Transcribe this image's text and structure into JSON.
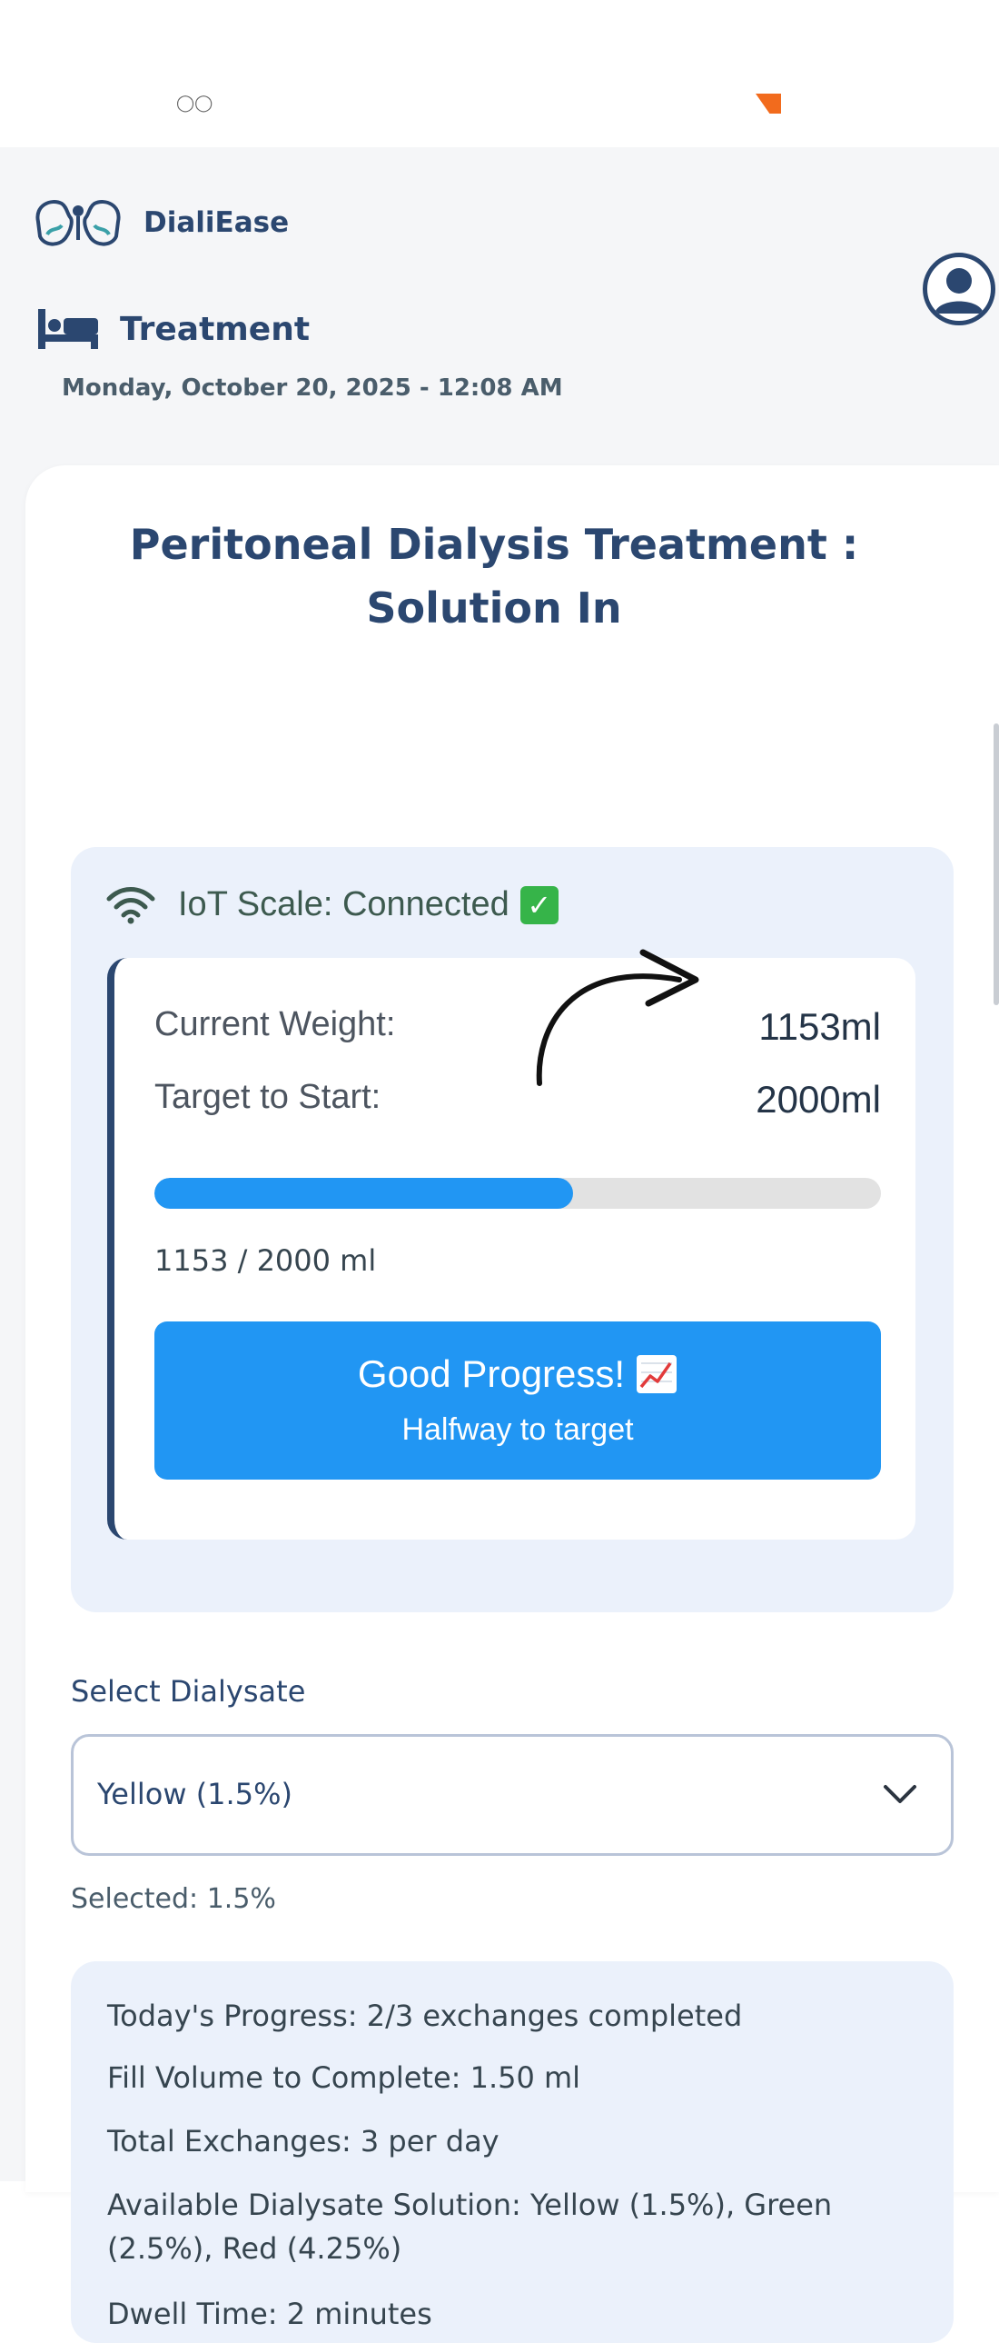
{
  "app": {
    "name": "DialiEase"
  },
  "header": {
    "section_title": "Treatment",
    "datetime": "Monday, October 20, 2025 - 12:08 AM"
  },
  "card": {
    "title_line1": "Peritoneal Dialysis Treatment :",
    "title_line2": "Solution In"
  },
  "scale": {
    "status_text": "IoT Scale: Connected",
    "current_weight_label": "Current Weight:",
    "current_weight_value": "1153ml",
    "target_label": "Target to Start:",
    "target_value": "2000ml",
    "progress_caption": "1153 / 2000 ml",
    "progress_fraction": 0.5765,
    "banner_title": "Good Progress!",
    "banner_subtitle": "Halfway to target"
  },
  "dialysate": {
    "label": "Select Dialysate",
    "selected_option": "Yellow (1.5%)",
    "selected_note": "Selected: 1.5%"
  },
  "info": {
    "line1": "Today's Progress: 2/3 exchanges completed",
    "line2": "Fill Volume to Complete: 1.50 ml",
    "line3": "Total Exchanges: 3 per day",
    "line4a": "Available Dialysate Solution: Yellow (1.5%), Green",
    "line4b": "(2.5%), Red (4.25%)",
    "line5": "Dwell Time: 2 minutes"
  },
  "colors": {
    "primary_navy": "#2b4770",
    "accent_blue": "#2196f3",
    "panel_bg": "#ebf1fb",
    "success_green": "#36b449"
  }
}
